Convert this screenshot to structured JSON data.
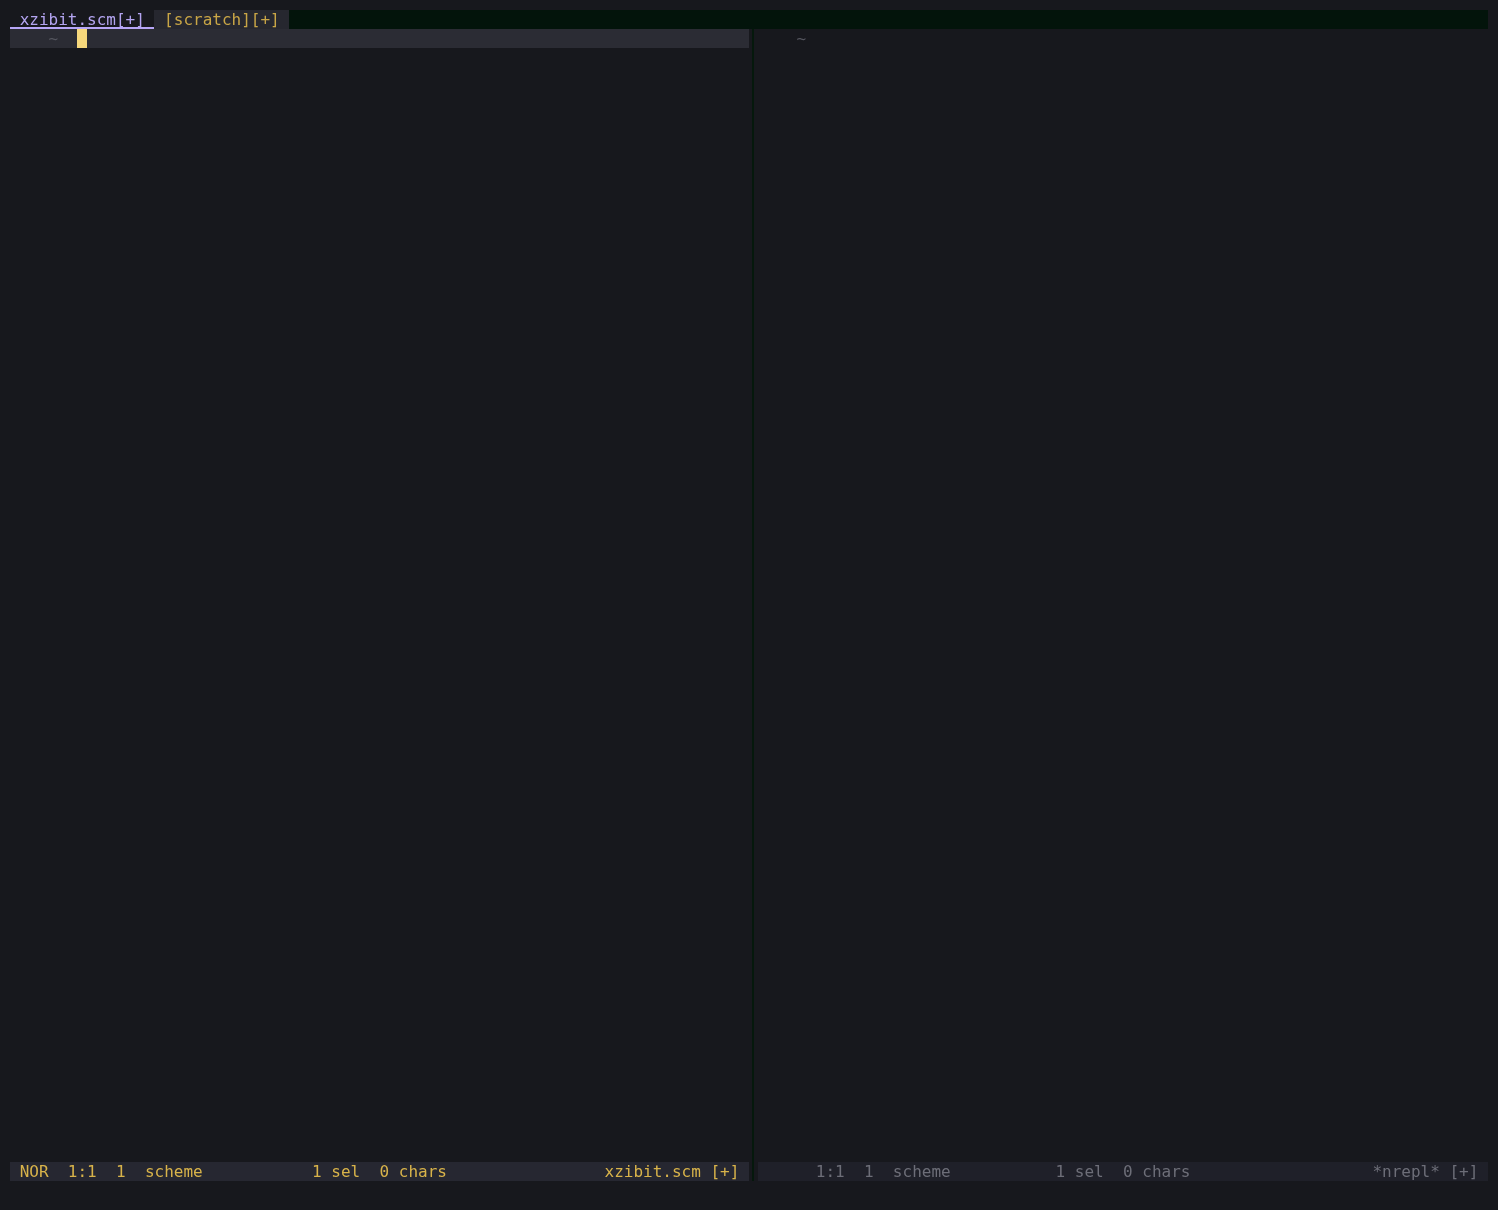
{
  "tabs": [
    {
      "label": "xzibit.scm[+]",
      "selected": true
    },
    {
      "label": "[scratch][+]",
      "selected": false
    }
  ],
  "panes": [
    {
      "focused": true,
      "lines": [
        {
          "gutter": "~",
          "cursor": true
        }
      ],
      "status": {
        "mode": "NOR",
        "position": "1:1",
        "line_count": "1",
        "language": "scheme",
        "selections": "1 sel",
        "chars": "0 chars",
        "file_name": "xzibit.scm",
        "modified": "[+]"
      }
    },
    {
      "focused": false,
      "lines": [
        {
          "gutter": "~",
          "cursor": false
        }
      ],
      "status": {
        "position": "1:1",
        "line_count": "1",
        "language": "scheme",
        "selections": "1 sel",
        "chars": "0 chars",
        "file_name": "*nrepl*",
        "modified": "[+]"
      }
    }
  ]
}
